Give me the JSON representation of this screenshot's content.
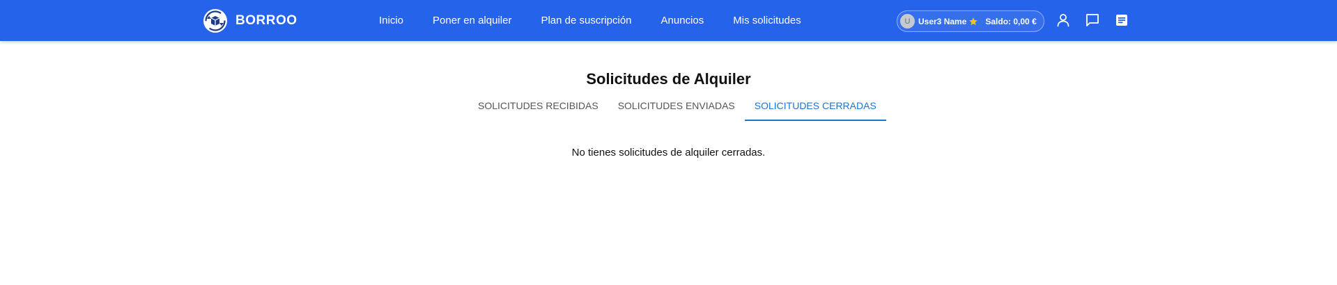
{
  "navbar": {
    "brand": "BORROO",
    "links": [
      "Inicio",
      "Poner en alquiler",
      "Plan de suscripción",
      "Anuncios",
      "Mis solicitudes"
    ],
    "user": {
      "avatar_initial": "U",
      "name": "User3 Name",
      "balance": "Saldo: 0,00 €"
    },
    "icons": [
      "star-icon",
      "person-icon",
      "chat-icon",
      "notes-icon"
    ],
    "colors": {
      "background": "#2563eb",
      "star": "#f5c518"
    }
  },
  "main": {
    "title": "Solicitudes de Alquiler",
    "tabs": [
      {
        "label": "Solicitudes recibidas",
        "active": false
      },
      {
        "label": "Solicitudes enviadas",
        "active": false
      },
      {
        "label": "Solicitudes cerradas",
        "active": true
      }
    ],
    "empty_message": "No tienes solicitudes de alquiler cerradas.",
    "colors": {
      "active_tab": "#1976d2"
    }
  }
}
